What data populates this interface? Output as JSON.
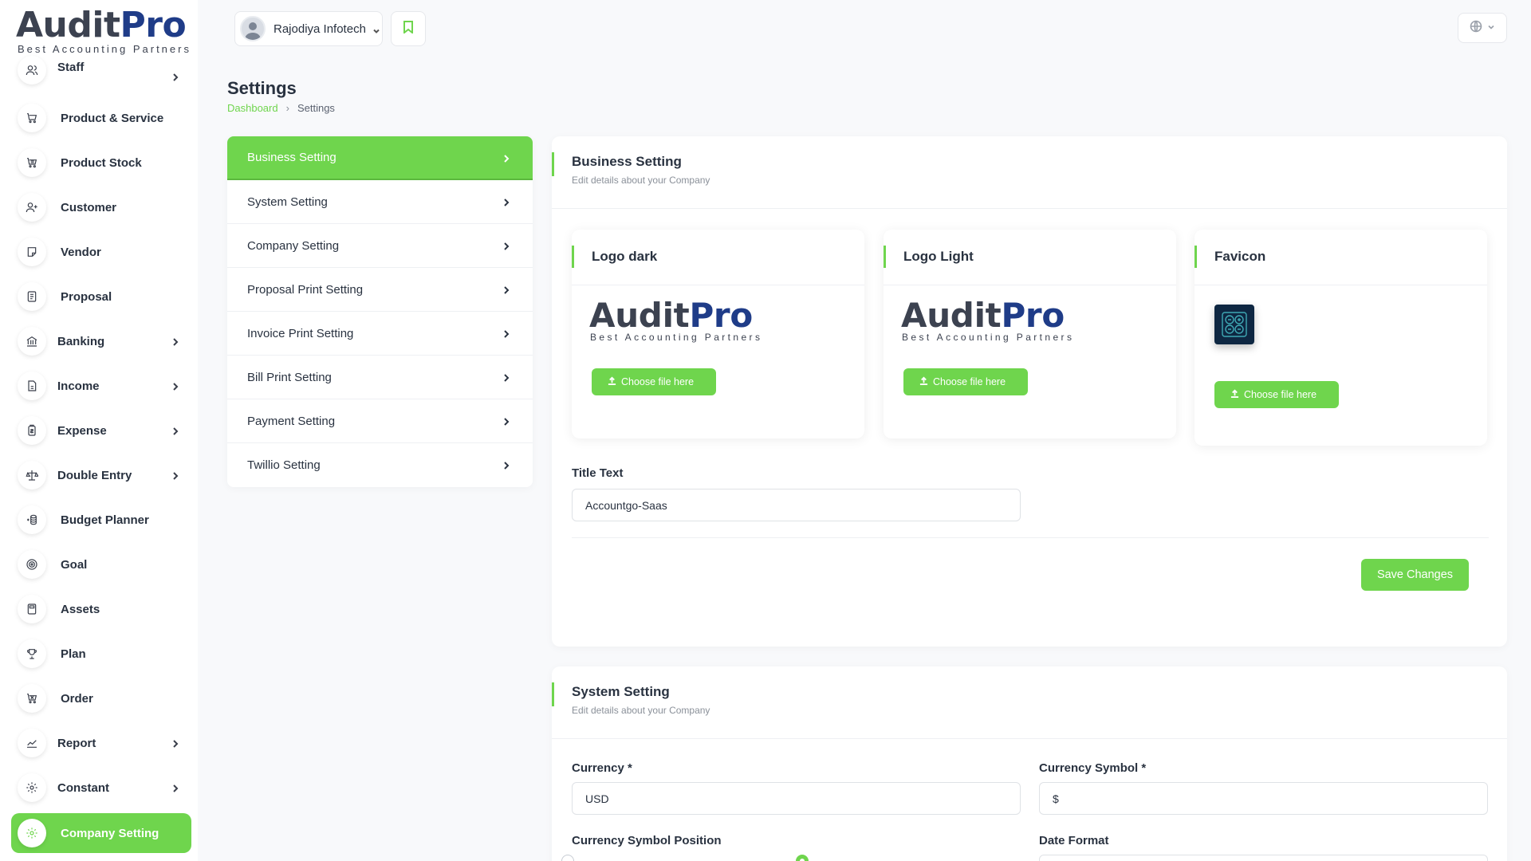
{
  "brand": {
    "name_a": "Audit",
    "name_b": "Pro",
    "tagline": "Best Accounting Partners"
  },
  "sidebar": {
    "items": [
      {
        "label": "Staff",
        "icon": "users-icon",
        "arrow": true
      },
      {
        "label": "Product & Service",
        "icon": "cart-icon",
        "arrow": false
      },
      {
        "label": "Product Stock",
        "icon": "cart-box-icon",
        "arrow": false
      },
      {
        "label": "Customer",
        "icon": "user-plus-icon",
        "arrow": false
      },
      {
        "label": "Vendor",
        "icon": "note-icon",
        "arrow": false
      },
      {
        "label": "Proposal",
        "icon": "file-text-icon",
        "arrow": false
      },
      {
        "label": "Banking",
        "icon": "bank-icon",
        "arrow": true
      },
      {
        "label": "Income",
        "icon": "file-income-icon",
        "arrow": true
      },
      {
        "label": "Expense",
        "icon": "clipboard-icon",
        "arrow": true
      },
      {
        "label": "Double Entry",
        "icon": "scale-icon",
        "arrow": true
      },
      {
        "label": "Budget Planner",
        "icon": "coins-icon",
        "arrow": false
      },
      {
        "label": "Goal",
        "icon": "target-icon",
        "arrow": false
      },
      {
        "label": "Assets",
        "icon": "calculator-icon",
        "arrow": false
      },
      {
        "label": "Plan",
        "icon": "trophy-icon",
        "arrow": false
      },
      {
        "label": "Order",
        "icon": "cart-off-icon",
        "arrow": false
      },
      {
        "label": "Report",
        "icon": "chart-line-icon",
        "arrow": true
      },
      {
        "label": "Constant",
        "icon": "gear-icon",
        "arrow": true
      },
      {
        "label": "Company Setting",
        "icon": "gear-icon",
        "arrow": false,
        "active": true
      }
    ]
  },
  "header": {
    "org_name": "Rajodiya Infotech",
    "language_icon": "globe-icon"
  },
  "page": {
    "title": "Settings",
    "breadcrumb": {
      "home": "Dashboard",
      "sep": "›",
      "current": "Settings"
    }
  },
  "settings_menu": [
    {
      "label": "Business Setting",
      "active": true
    },
    {
      "label": "System Setting"
    },
    {
      "label": "Company Setting"
    },
    {
      "label": "Proposal Print Setting"
    },
    {
      "label": "Invoice Print Setting"
    },
    {
      "label": "Bill Print Setting"
    },
    {
      "label": "Payment Setting"
    },
    {
      "label": "Twillio Setting"
    }
  ],
  "business": {
    "title": "Business Setting",
    "subtitle": "Edit details about your Company",
    "logo_dark_title": "Logo dark",
    "logo_light_title": "Logo Light",
    "favicon_title": "Favicon",
    "choose_label": "Choose file here",
    "title_text_label": "Title Text",
    "title_text_value": "Accountgo-Saas",
    "save_label": "Save Changes"
  },
  "system": {
    "title": "System Setting",
    "subtitle": "Edit details about your Company",
    "currency_label": "Currency *",
    "currency_value": "USD",
    "currency_symbol_label": "Currency Symbol *",
    "currency_symbol_value": "$",
    "symbol_position_label": "Currency Symbol Position",
    "date_format_label": "Date Format"
  },
  "colors": {
    "accent": "#6fd54d",
    "brand_blue": "#1f3c88",
    "text": "#293240"
  }
}
